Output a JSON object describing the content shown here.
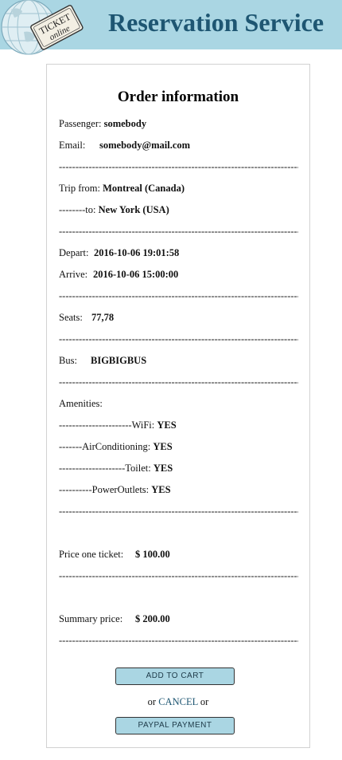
{
  "header": {
    "title": "Reservation Service",
    "logo_text": [
      "TICKET",
      "online"
    ],
    "bg_color": "#aad6e3",
    "title_color": "#1e5672"
  },
  "order": {
    "title": "Order information",
    "separator": "--------------------------------------------------------------------------------------------",
    "passenger_label": "Passenger:",
    "passenger_value": "somebody",
    "email_label": "Email:",
    "email_value": "somebody@mail.com",
    "trip_from_label": "Trip from:",
    "trip_from_value": "Montreal (Canada)",
    "trip_to_label": "--------to:",
    "trip_to_value": "New York (USA)",
    "depart_label": "Depart:",
    "depart_value": "2016-10-06 19:01:58",
    "arrive_label": "Arrive:",
    "arrive_value": "2016-10-06 15:00:00",
    "seats_label": "Seats:",
    "seats_value": "77,78",
    "bus_label": "Bus:",
    "bus_value": "BIGBIGBUS",
    "amenities_label": "Amenities:",
    "amenities": [
      {
        "label": "----------------------WiFi:",
        "value": "YES"
      },
      {
        "label": "-------AirConditioning:",
        "value": "YES"
      },
      {
        "label": "--------------------Toilet:",
        "value": "YES"
      },
      {
        "label": "----------PowerOutlets:",
        "value": "YES"
      }
    ],
    "price_label": "Price one ticket:",
    "price_value": "$ 100.00",
    "summary_label": "Summary price:",
    "summary_value": "$ 200.00"
  },
  "actions": {
    "add_to_cart": "ADD TO CART",
    "or_prefix": "or",
    "cancel": "CANCEL",
    "or_suffix": "or",
    "paypal": "PAYPAL PAYMENT"
  }
}
